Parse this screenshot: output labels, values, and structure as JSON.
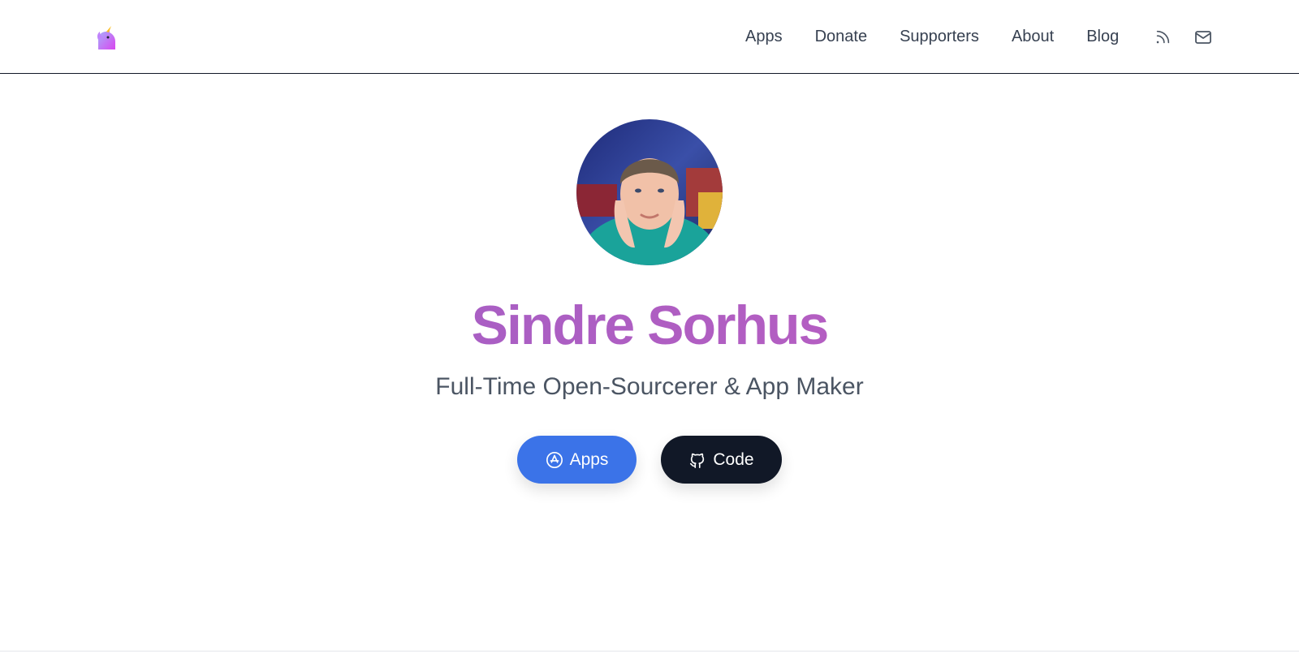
{
  "header": {
    "logo_icon": "unicorn-icon",
    "nav": [
      {
        "label": "Apps"
      },
      {
        "label": "Donate"
      },
      {
        "label": "Supporters"
      },
      {
        "label": "About"
      },
      {
        "label": "Blog"
      }
    ],
    "icons": [
      "rss-icon",
      "mail-icon"
    ]
  },
  "hero": {
    "avatar_icon": "profile-photo",
    "name": "Sindre Sorhus",
    "tagline": "Full-Time Open-Sourcerer & App Maker",
    "buttons": {
      "apps_label": "Apps",
      "code_label": "Code"
    }
  },
  "colors": {
    "accent_blue": "#3b73e8",
    "dark": "#111827",
    "name_gradient_start": "#9b5fc6",
    "name_gradient_end": "#c25ebf"
  }
}
